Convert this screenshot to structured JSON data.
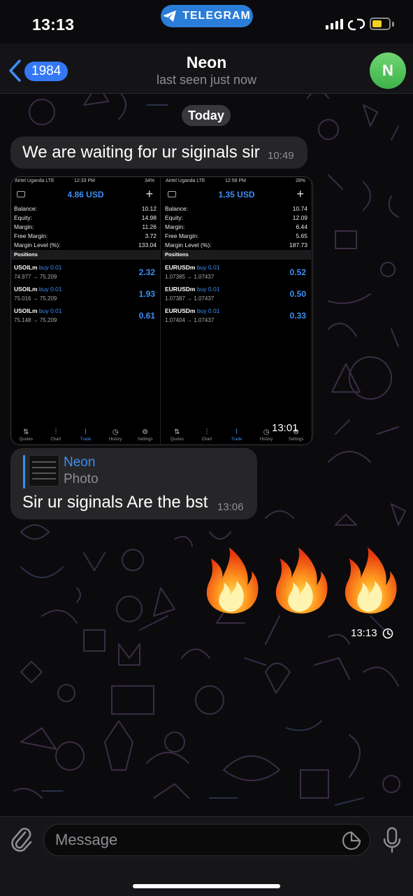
{
  "status_bar": {
    "time": "13:13",
    "app_pill_label": "TELEGRAM",
    "battery_color": "#f5d020"
  },
  "header": {
    "back_badge": "1984",
    "title": "Neon",
    "subtitle": "last seen just now",
    "avatar_initial": "N",
    "avatar_color": "#4cc45a"
  },
  "chat": {
    "date_separator": "Today",
    "messages": [
      {
        "text": "We are waiting for ur siginals sir",
        "time": "10:49"
      },
      {
        "type": "photo",
        "time": "13:01",
        "screenshots": [
          {
            "carrier": "Airtel Uganda  LTE",
            "time": "12:33 PM",
            "battery": "34%",
            "balance_title": "4.86 USD",
            "account": [
              {
                "label": "Balance:",
                "value": "10.12"
              },
              {
                "label": "Equity:",
                "value": "14.98"
              },
              {
                "label": "Margin:",
                "value": "11.26"
              },
              {
                "label": "Free Margin:",
                "value": "3.72"
              },
              {
                "label": "Margin Level (%):",
                "value": "133.04"
              }
            ],
            "positions_header": "Positions",
            "positions": [
              {
                "symbol": "USOILm",
                "side": "buy 0.01",
                "prices": "74.977 → 75.209",
                "pnl": "2.32"
              },
              {
                "symbol": "USOILm",
                "side": "buy 0.01",
                "prices": "75.016 → 75.209",
                "pnl": "1.93"
              },
              {
                "symbol": "USOILm",
                "side": "buy 0.01",
                "prices": "75.148 → 75.209",
                "pnl": "0.61"
              }
            ],
            "tabs": [
              "Quotes",
              "Chart",
              "Trade",
              "History",
              "Settings"
            ]
          },
          {
            "carrier": "Airtel Uganda  LTE",
            "time": "12:58 PM",
            "battery": "28%",
            "balance_title": "1.35 USD",
            "account": [
              {
                "label": "Balance:",
                "value": "10.74"
              },
              {
                "label": "Equity:",
                "value": "12.09"
              },
              {
                "label": "Margin:",
                "value": "6.44"
              },
              {
                "label": "Free Margin:",
                "value": "5.65"
              },
              {
                "label": "Margin Level (%):",
                "value": "187.73"
              }
            ],
            "positions_header": "Positions",
            "positions": [
              {
                "symbol": "EURUSDm",
                "side": "buy 0.01",
                "prices": "1.07385 → 1.07437",
                "pnl": "0.52"
              },
              {
                "symbol": "EURUSDm",
                "side": "buy 0.01",
                "prices": "1.07387 → 1.07437",
                "pnl": "0.50"
              },
              {
                "symbol": "EURUSDm",
                "side": "buy 0.01",
                "prices": "1.07404 → 1.07437",
                "pnl": "0.33"
              }
            ],
            "tabs": [
              "Quotes",
              "Chart",
              "Trade",
              "History",
              "Settings"
            ]
          }
        ]
      },
      {
        "reply_to": {
          "name": "Neon",
          "type": "Photo"
        },
        "text": "Sir ur siginals Are the bst",
        "time": "13:06"
      },
      {
        "type": "emoji",
        "outgoing": true,
        "emoji": [
          "🔥",
          "🔥",
          "🔥"
        ],
        "time": "13:13"
      }
    ]
  },
  "input": {
    "placeholder": "Message"
  },
  "colors": {
    "accent": "#3d8ef5",
    "bubble_in": "#262628",
    "background": "#0b0b0d"
  }
}
